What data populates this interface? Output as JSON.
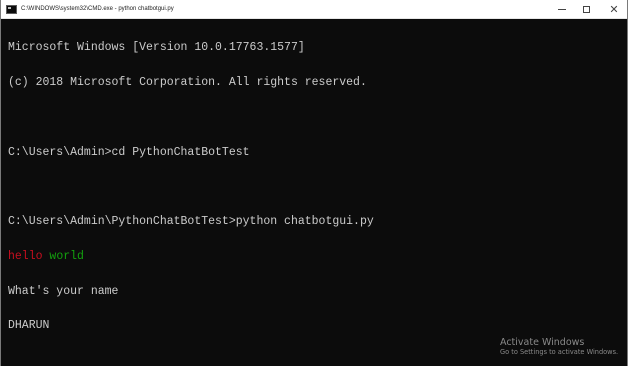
{
  "window": {
    "title": "C:\\WINDOWS\\system32\\CMD.exe - python  chatbotgui.py",
    "controls": {
      "minimize": "minimize-icon",
      "maximize": "maximize-icon",
      "close": "close-icon"
    }
  },
  "console": {
    "lines": [
      "Microsoft Windows [Version 10.0.17763.1577]",
      "(c) 2018 Microsoft Corporation. All rights reserved.",
      "",
      "C:\\Users\\Admin>cd PythonChatBotTest",
      "",
      "C:\\Users\\Admin\\PythonChatBotTest>python chatbotgui.py"
    ],
    "colored_line": {
      "part1": "hello",
      "part2": " world"
    },
    "lines_after": [
      "What's your name",
      "DHARUN"
    ],
    "colors": {
      "text": "#cccccc",
      "background": "#0c0c0c",
      "hello": "#c50f1f",
      "world": "#13a10e"
    }
  },
  "watermark": {
    "title": "Activate Windows",
    "subtitle": "Go to Settings to activate Windows."
  }
}
